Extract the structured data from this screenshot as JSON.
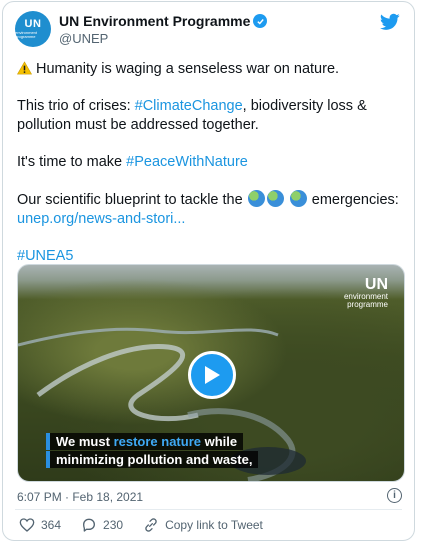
{
  "account": {
    "avatar_text": "UN",
    "avatar_subtext": "environment programme",
    "display_name": "UN Environment Programme",
    "handle": "@UNEP"
  },
  "tweet": {
    "line1": "Humanity is waging a senseless war on nature.",
    "p2_before": "This trio of crises: ",
    "p2_hashtag": "#ClimateChange",
    "p2_after": ", biodiversity loss & pollution must be addressed together.",
    "p3_before": "It's time to make ",
    "p3_hashtag": "#PeaceWithNature",
    "p4_before": "Our scientific blueprint to tackle the ",
    "p4_after": " emergencies:",
    "p4_link": "unep.org/news-and-stori...",
    "p5_hashtag": "#UNEA5"
  },
  "media": {
    "brand": "UN",
    "brand_sub1": "environment",
    "brand_sub2": "programme",
    "caption_line1_a": "We must ",
    "caption_line1_b": "restore nature",
    "caption_line1_c": " while",
    "caption_line2": "minimizing pollution and waste,"
  },
  "timestamp": "6:07 PM · Feb 18, 2021",
  "info_label": "i",
  "actions": {
    "likes": "364",
    "replies": "230",
    "copy_link": "Copy link to Tweet"
  },
  "colors": {
    "link": "#1b95e0",
    "verified": "#1d9bf0",
    "avatar": "#1f8ecf"
  }
}
